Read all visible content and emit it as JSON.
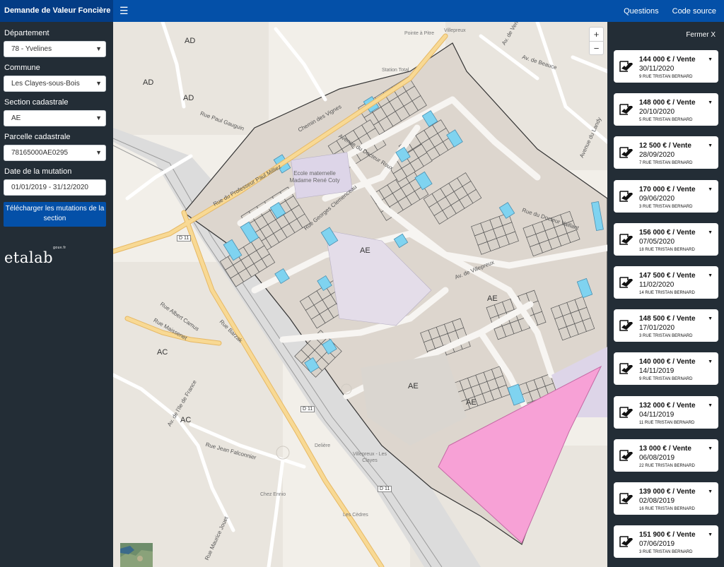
{
  "header": {
    "title": "Demande de Valeur Foncière",
    "menu_icon": "hamburger-icon",
    "links": [
      "Questions",
      "Code source"
    ]
  },
  "sidebar": {
    "departement_label": "Département",
    "departement_value": "78 - Yvelines",
    "commune_label": "Commune",
    "commune_value": "Les Clayes-sous-Bois",
    "section_label": "Section cadastrale",
    "section_value": "AE",
    "parcelle_label": "Parcelle cadastrale",
    "parcelle_value": "78165000AE0295",
    "date_label": "Date de la mutation",
    "date_value": "01/01/2019 - 31/12/2020",
    "download_label": "Télécharger les mutations de la section",
    "logo_text": "etalab",
    "logo_sup": "gouv.fr"
  },
  "map": {
    "zoom_in": "+",
    "zoom_out": "−",
    "labels": [
      "AD",
      "AD",
      "AD",
      "AE",
      "AE",
      "AE",
      "AE",
      "AC",
      "AC",
      "Rue Paul Gauguin",
      "Chemin des Vignes",
      "Rue du Professeur Paul Milliez",
      "Avenue du Docteur Roux",
      "Rue Georges Clemenceau",
      "Ecole maternelle Madame René Coty",
      "Av. de Villepreux",
      "Av. de Vendée",
      "Av. de Beauce",
      "Avenue du Landy",
      "Rue du Docteur Vaillant",
      "Rue Albert Camus",
      "Rue Maissenet",
      "Rue Barzak",
      "Av. de l'Ile de France",
      "Rue Jean Falconnier",
      "Rue Maurice Jouet",
      "Station Total",
      "Pointe à Pitre",
      "Villepreux",
      "Villepreux - Les Clayes",
      "Delière",
      "Chez Ennio",
      "Les Cèdres",
      "D 11",
      "D 11",
      "D 11"
    ]
  },
  "panel": {
    "close_label": "Fermer X",
    "icon": "sale-document-icon",
    "transactions": [
      {
        "price": "144 000 € / Vente",
        "date": "30/11/2020",
        "address": "9 RUE TRISTAN BERNARD"
      },
      {
        "price": "148 000 € / Vente",
        "date": "20/10/2020",
        "address": "5 RUE TRISTAN BERNARD"
      },
      {
        "price": "12 500 € / Vente",
        "date": "28/09/2020",
        "address": "7 RUE TRISTAN BERNARD"
      },
      {
        "price": "170 000 € / Vente",
        "date": "09/06/2020",
        "address": "3 RUE TRISTAN BERNARD"
      },
      {
        "price": "156 000 € / Vente",
        "date": "07/05/2020",
        "address": "18 RUE TRISTAN BERNARD"
      },
      {
        "price": "147 500 € / Vente",
        "date": "11/02/2020",
        "address": "14 RUE TRISTAN BERNARD"
      },
      {
        "price": "148 500 € / Vente",
        "date": "17/01/2020",
        "address": "3 RUE TRISTAN BERNARD"
      },
      {
        "price": "140 000 € / Vente",
        "date": "14/11/2019",
        "address": "9 RUE TRISTAN BERNARD"
      },
      {
        "price": "132 000 € / Vente",
        "date": "04/11/2019",
        "address": "11 RUE TRISTAN BERNARD"
      },
      {
        "price": "13 000 € / Vente",
        "date": "06/08/2019",
        "address": "22 RUE TRISTAN BERNARD"
      },
      {
        "price": "139 000 € / Vente",
        "date": "02/08/2019",
        "address": "16 RUE TRISTAN BERNARD"
      },
      {
        "price": "151 900 € / Vente",
        "date": "07/06/2019",
        "address": "3 RUE TRISTAN BERNARD"
      }
    ]
  },
  "colors": {
    "navbar": "#0450a8",
    "brand": "#033c85",
    "sidebar": "#232d36",
    "map_bg": "#f2efe9",
    "parcel_fill": "#e2ddd8",
    "highlight_parcel": "#7fd3f0",
    "selected_parcel": "#f7a1d6",
    "main_road": "#f6cf7b"
  }
}
